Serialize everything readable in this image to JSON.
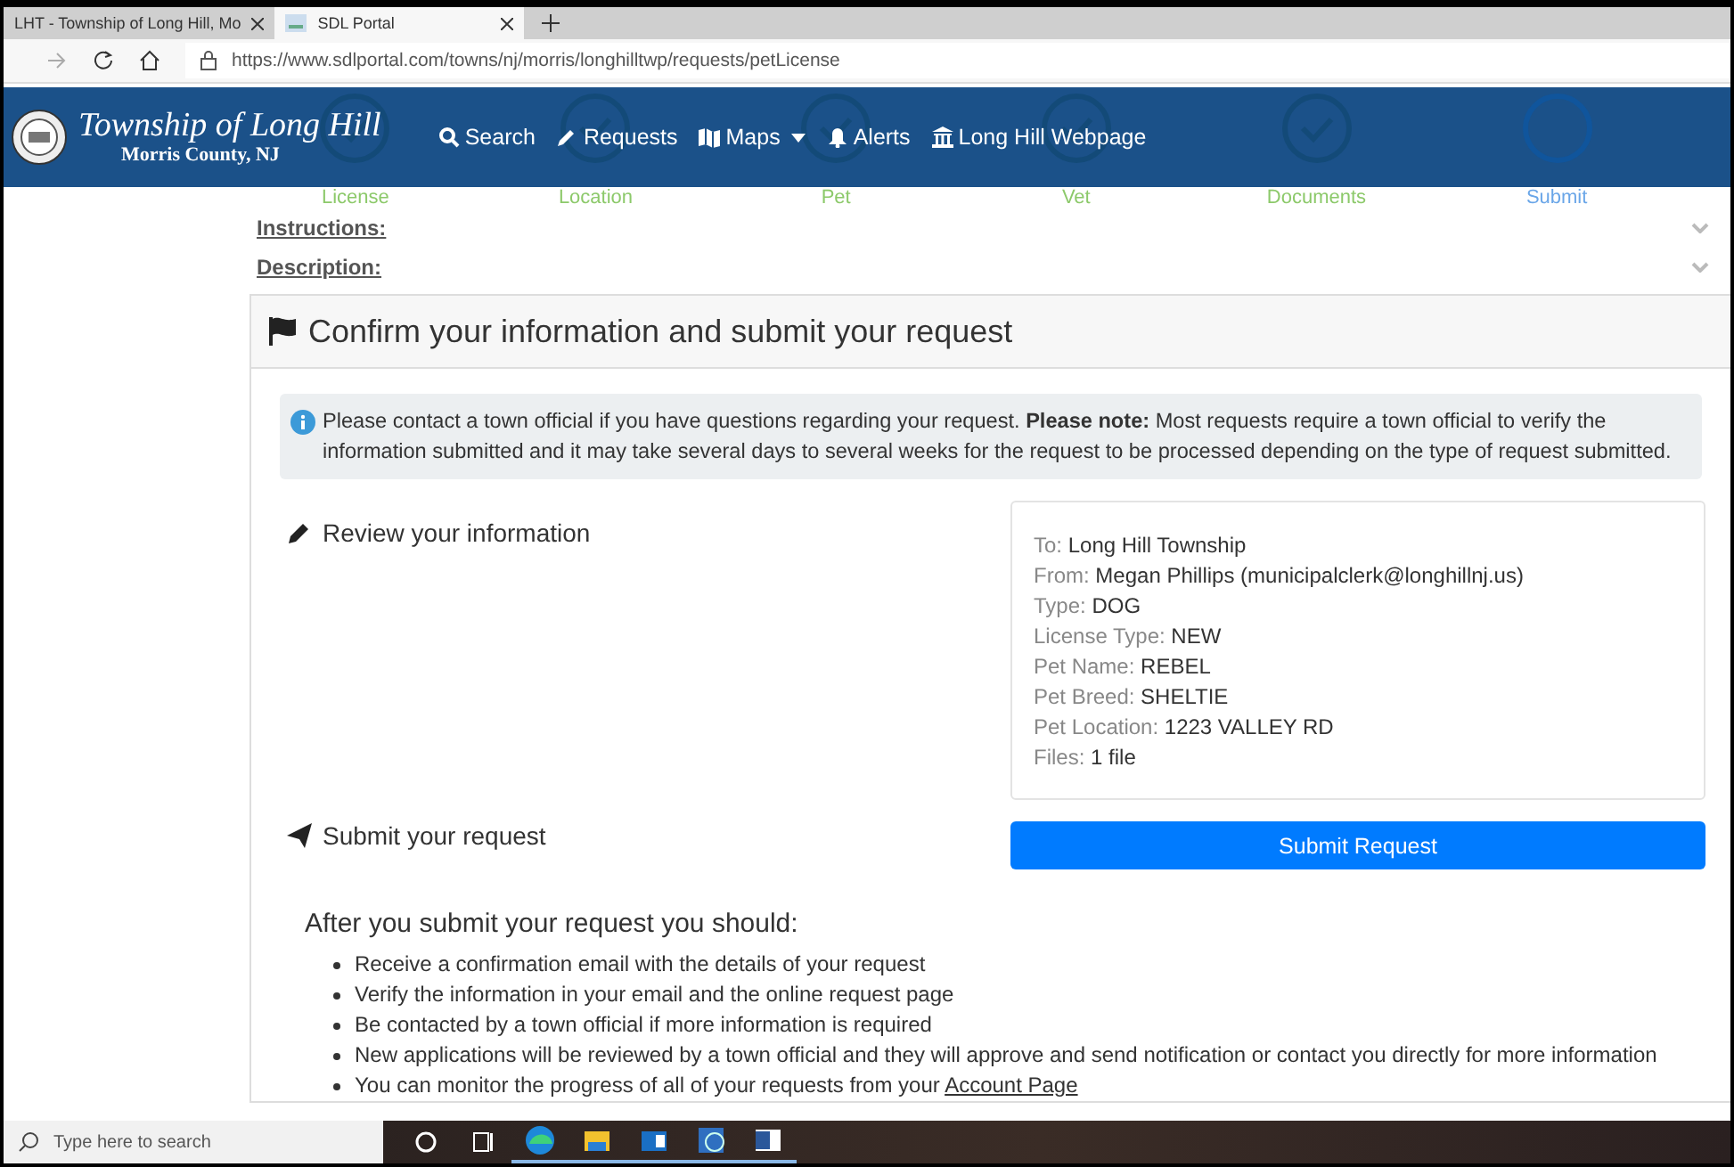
{
  "browser": {
    "tabs": [
      {
        "title": "LHT - Township of Long Hill, Mo",
        "selected": false
      },
      {
        "title": "SDL Portal",
        "selected": true
      }
    ],
    "url": "https://www.sdlportal.com/towns/nj/morris/longhilltwp/requests/petLicense"
  },
  "navbar": {
    "title": "Township of Long Hill",
    "subtitle": "Morris County, NJ",
    "links": [
      {
        "kind": "search",
        "label": "Search"
      },
      {
        "kind": "requests",
        "label": "Requests"
      },
      {
        "kind": "maps",
        "label": "Maps",
        "dropdown": true
      },
      {
        "kind": "alerts",
        "label": "Alerts"
      },
      {
        "kind": "webpage",
        "label": "Long Hill Webpage"
      }
    ]
  },
  "steps": [
    {
      "label": "License",
      "done": true
    },
    {
      "label": "Location",
      "done": true
    },
    {
      "label": "Pet",
      "done": true
    },
    {
      "label": "Vet",
      "done": true
    },
    {
      "label": "Documents",
      "done": true
    },
    {
      "label": "Submit",
      "done": false
    }
  ],
  "sections": [
    {
      "label": "Instructions:",
      "expanded": false
    },
    {
      "label": "Description:",
      "expanded": false
    }
  ],
  "card": {
    "title": "Confirm your information and submit your request",
    "alert": "Please contact a town official if you have questions regarding your request. **Please note:** Most requests require a town official to verify the information submitted and it may take several days to several weeks for the request to be processed depending on the type of request submitted.",
    "review_heading": "Review your information",
    "review": [
      {
        "label": "To:",
        "value": "Long Hill Township"
      },
      {
        "label": "From:",
        "value": "Megan Phillips (municipalclerk@longhillnj.us)"
      },
      {
        "label": "Type:",
        "value": "DOG"
      },
      {
        "label": "License Type:",
        "value": "NEW"
      },
      {
        "label": "Pet Name:",
        "value": "REBEL"
      },
      {
        "label": "Pet Breed:",
        "value": "SHELTIE"
      },
      {
        "label": "Pet Location:",
        "value": "1223 VALLEY RD"
      },
      {
        "label": "Files:",
        "value": "1 file"
      }
    ],
    "submit_heading": "Submit your request",
    "submit_button": "Submit Request",
    "after_heading": "After you submit your request you should:",
    "after_items": [
      {
        "text": "Receive a confirmation email with the details of your request"
      },
      {
        "text": "Verify the information in your email and the online request page"
      },
      {
        "text": "Be contacted by a town official if more information is required"
      },
      {
        "text": "New applications will be reviewed by a town official and they will approve and send notification or contact you directly for more information"
      },
      {
        "text": "You can monitor the progress of all of your requests from your",
        "link": "Account Page"
      }
    ]
  },
  "taskbar": {
    "search_placeholder": "Type here to search",
    "apps": [
      {
        "kind": "cortana",
        "active": false
      },
      {
        "kind": "taskview",
        "active": false
      },
      {
        "kind": "edge",
        "active": true
      },
      {
        "kind": "folder",
        "active": true
      },
      {
        "kind": "mail",
        "active": true
      },
      {
        "kind": "globe",
        "active": true
      },
      {
        "kind": "word",
        "active": true
      }
    ]
  }
}
